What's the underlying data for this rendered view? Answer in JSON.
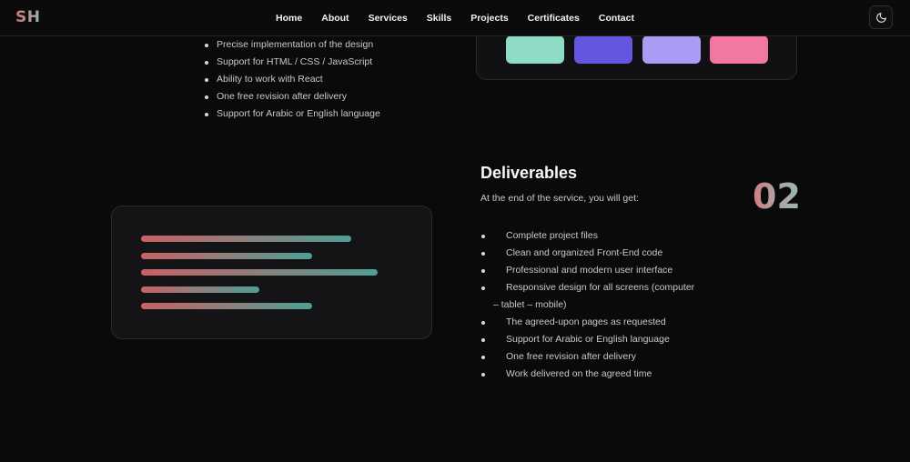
{
  "nav": {
    "logo": "SH",
    "links": [
      "Home",
      "About",
      "Services",
      "Skills",
      "Projects",
      "Certificates",
      "Contact"
    ],
    "theme_toggle_icon": "moon-icon"
  },
  "service_one": {
    "features": [
      "Precise implementation of the design",
      "Support for HTML / CSS / JavaScript",
      "Ability to work with React",
      "One free revision after delivery",
      "Support for Arabic or English language"
    ],
    "palette": [
      "#8fdcc6",
      "#6357e0",
      "#a99cf5",
      "#f2789f"
    ]
  },
  "service_two": {
    "title": "Deliverables",
    "subtitle": "At the end of the service, you will get:",
    "number": "02",
    "items": [
      "Complete project files",
      "Clean and organized Front-End code",
      "Professional and modern user interface",
      "Responsive design for all screens (computer – tablet – mobile)",
      "The agreed-upon pages as requested",
      "Support for Arabic or English language",
      "One free revision after delivery",
      "Work delivered on the agreed time"
    ]
  },
  "colors": {
    "background": "#0a0a0b",
    "gradient_start": "#c86165",
    "gradient_end": "#4f9f94"
  }
}
